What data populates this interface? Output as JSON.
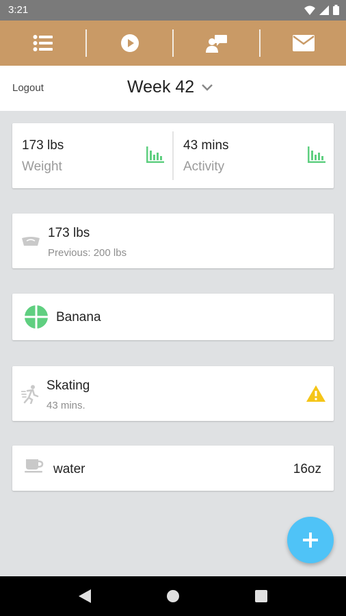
{
  "status_bar": {
    "time": "3:21"
  },
  "header": {
    "logout_label": "Logout",
    "week_label": "Week 42"
  },
  "summary": {
    "weight": {
      "value": "173 lbs",
      "label": "Weight"
    },
    "activity": {
      "value": "43 mins",
      "label": "Activity"
    }
  },
  "entries": {
    "weight": {
      "title": "173 lbs",
      "subtitle": "Previous: 200 lbs"
    },
    "food": {
      "title": "Banana"
    },
    "activity": {
      "title": "Skating",
      "subtitle": "43 mins."
    },
    "drink": {
      "title": "water",
      "amount": "16oz"
    }
  },
  "colors": {
    "toolbar": "#c99a66",
    "chart_icon": "#5fcf80",
    "food_icon": "#5fcf80",
    "warning": "#f5c518",
    "fab": "#4fc3f7"
  },
  "icons": {
    "toolbar": [
      "list-icon",
      "play-icon",
      "contact-icon",
      "mail-icon"
    ],
    "summary": [
      "bar-chart-icon",
      "bar-chart-icon"
    ],
    "entries": [
      "scale-icon",
      "food-icon",
      "running-icon",
      "cup-icon"
    ]
  }
}
